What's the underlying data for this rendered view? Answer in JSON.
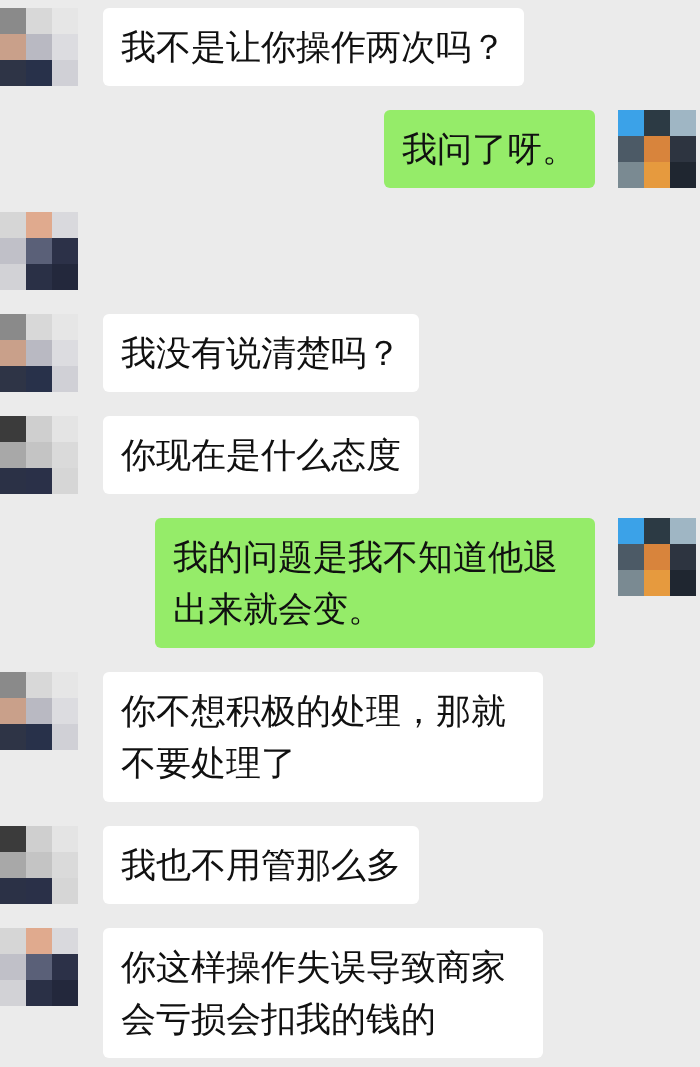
{
  "messages": [
    {
      "kind": "received",
      "text": "我不是让你操作两次吗？"
    },
    {
      "kind": "sent",
      "text": "我问了呀。"
    },
    {
      "kind": "received"
    },
    {
      "kind": "received",
      "text": "我没有说清楚吗？"
    },
    {
      "kind": "received",
      "text": "你现在是什么态度"
    },
    {
      "kind": "sent",
      "text": "我的问题是我不知道他退出来就会变。"
    },
    {
      "kind": "received",
      "text": "你不想积极的处理，那就不要处理了"
    },
    {
      "kind": "received",
      "text": "我也不用管那么多"
    },
    {
      "kind": "received",
      "text": "你这样操作失误导致商家会亏损会扣我的钱的"
    }
  ]
}
